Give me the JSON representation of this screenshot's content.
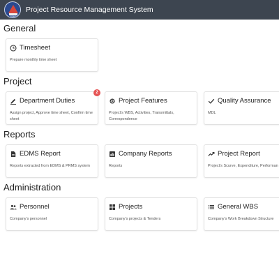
{
  "app": {
    "title": "Project Resource Management System"
  },
  "sections": {
    "general": {
      "title": "General",
      "cards": [
        {
          "title": "Timesheet",
          "desc": "Prepare monthly time sheet",
          "icon": "clock-icon"
        }
      ]
    },
    "project": {
      "title": "Project",
      "cards": [
        {
          "title": "Department Duties",
          "desc": "Assign project, Approve time sheet, Confirm time sheet",
          "icon": "pencil-icon",
          "badge": "2"
        },
        {
          "title": "Project Features",
          "desc": "Project's WBS, Activities, Transmittals, Correspondence",
          "icon": "gear-icon"
        },
        {
          "title": "Quality Assurance",
          "desc": "MDL",
          "icon": "check-icon"
        }
      ]
    },
    "reports": {
      "title": "Reports",
      "cards": [
        {
          "title": "EDMS Report",
          "desc": "Reports extracted from EDMS & PRMS system",
          "icon": "document-icon"
        },
        {
          "title": "Company Reports",
          "desc": "Reports",
          "icon": "image-report-icon"
        },
        {
          "title": "Project Report",
          "desc": "Project's Scurve, Expenditure, Performan",
          "icon": "trending-icon"
        }
      ]
    },
    "administration": {
      "title": "Administration",
      "cards": [
        {
          "title": "Personnel",
          "desc": "Company's personnel",
          "icon": "people-icon"
        },
        {
          "title": "Projects",
          "desc": "Company's projects & Tenders",
          "icon": "grid-icon"
        },
        {
          "title": "General WBS",
          "desc": "Company's Work Breakdown Structure",
          "icon": "list-icon"
        }
      ]
    }
  },
  "colors": {
    "topbar": "#3d4550",
    "badge": "#e55353",
    "card_border": "#e1e1e1"
  }
}
